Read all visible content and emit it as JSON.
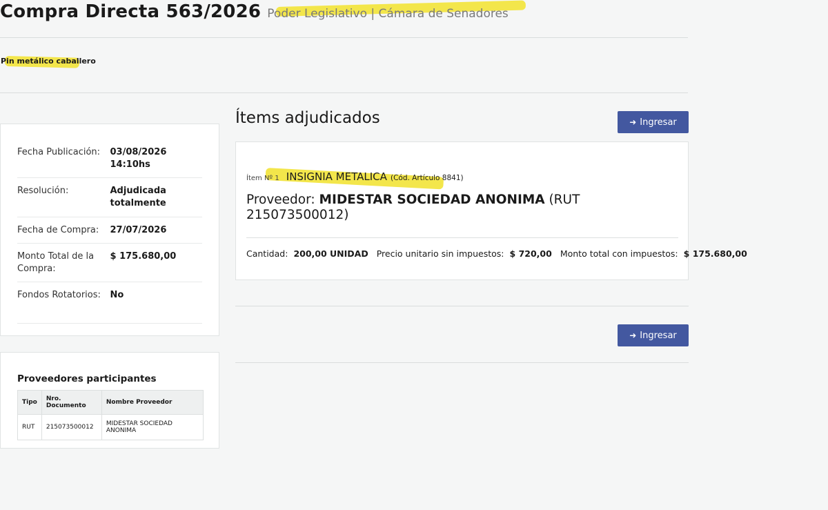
{
  "header": {
    "title": "Compra Directa 563/2026",
    "organization": "Poder Legislativo | Cámara de Senadores"
  },
  "product": {
    "prefix": "Pin ",
    "highlighted": "metálico caballero"
  },
  "info": [
    {
      "label": "Fecha Publicación:",
      "value": "03/08/2026 14:10hs"
    },
    {
      "label": "Resolución:",
      "value": "Adjudicada totalmente"
    },
    {
      "label": "Fecha de Compra:",
      "value": "27/07/2026"
    },
    {
      "label": "Monto Total de la Compra:",
      "value": "$ 175.680,00"
    },
    {
      "label": "Fondos Rotatorios:",
      "value": "No"
    }
  ],
  "providers": {
    "title": "Proveedores participantes",
    "columns": [
      "Tipo",
      "Nro. Documento",
      "Nombre Proveedor"
    ],
    "rows": [
      [
        "RUT",
        "215073500012",
        "MIDESTAR SOCIEDAD ANONIMA"
      ]
    ]
  },
  "items": {
    "title": "Ítems adjudicados",
    "button_label": "Ingresar",
    "item_number": "Ítem Nº 1",
    "item_name": "INSIGNIA METALICA",
    "item_code": "(Cód. Artículo 8841",
    "item_code_close": ")",
    "supplier_prefix": "Proveedor: ",
    "supplier_name": "MIDESTAR SOCIEDAD ANONIMA",
    "supplier_rut": " (RUT 215073500012)",
    "qty_label": "Cantidad:",
    "qty_value": "200,00 UNIDAD",
    "unit_price_label": "Precio unitario sin impuestos:",
    "unit_price_value": "$ 720,00",
    "total_label": "Monto total con impuestos:",
    "total_value": "$ 175.680,00"
  },
  "colors": {
    "primary_button": "#4358a0",
    "highlighter": "#f3e64b"
  }
}
